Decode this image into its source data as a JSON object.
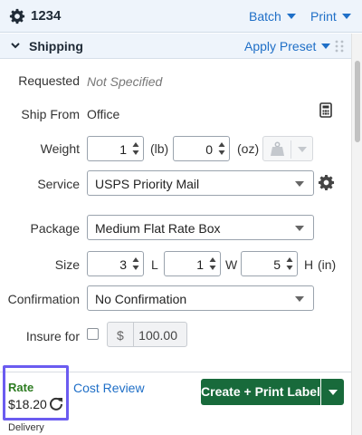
{
  "header": {
    "order_number": "1234",
    "batch_label": "Batch",
    "print_label": "Print"
  },
  "section": {
    "title": "Shipping",
    "preset_label": "Apply Preset"
  },
  "form": {
    "requested_label": "Requested",
    "requested_value": "Not Specified",
    "ship_from_label": "Ship From",
    "ship_from_value": "Office",
    "weight_label": "Weight",
    "weight_lb": "1",
    "weight_lb_unit": "(lb)",
    "weight_oz": "0",
    "weight_oz_unit": "(oz)",
    "service_label": "Service",
    "service_value": "USPS Priority Mail",
    "package_label": "Package",
    "package_value": "Medium Flat Rate Box",
    "size_label": "Size",
    "size_l": "3",
    "size_l_unit": "L",
    "size_w": "1",
    "size_w_unit": "W",
    "size_h": "5",
    "size_h_unit": "H",
    "size_unit": "(in)",
    "confirmation_label": "Confirmation",
    "confirmation_value": "No Confirmation",
    "insure_label": "Insure for",
    "insure_checked": false,
    "insure_currency": "$",
    "insure_amount": "100.00"
  },
  "footer": {
    "rate_label": "Rate",
    "rate_value": "$18.20",
    "cost_review_label": "Cost Review",
    "create_button_label": "Create + Print Label",
    "delivery_label": "Delivery"
  },
  "colors": {
    "accent": "#1f6fc7",
    "primary_button": "#186a3b",
    "rate_label": "#2d7c21",
    "highlight_box": "#6b5cf0",
    "header_bg": "#eef4fb"
  },
  "icons": {
    "order": "gear-icon",
    "calculator": "calculator-icon",
    "scale": "scale-icon",
    "service_settings": "gear-icon",
    "refresh": "refresh-icon"
  }
}
